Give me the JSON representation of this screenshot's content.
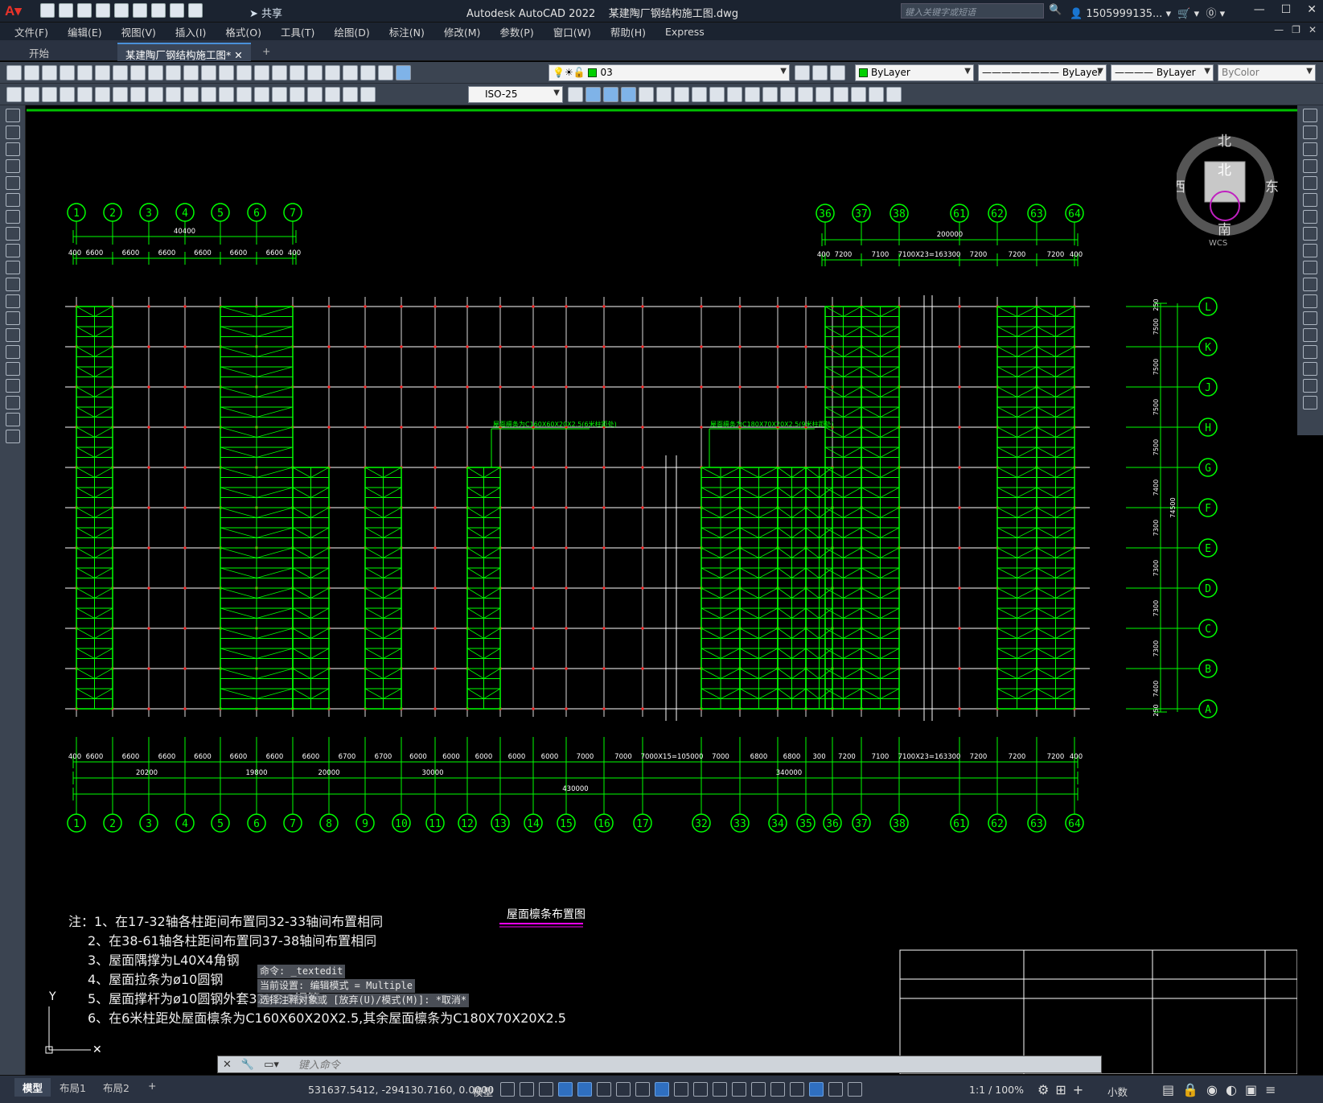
{
  "app": {
    "title": "Autodesk AutoCAD 2022",
    "file": "某建陶厂钢结构施工图.dwg",
    "share_label": "共享"
  },
  "search": {
    "placeholder": "键入关键字或短语"
  },
  "user": {
    "name": "1505999135..."
  },
  "menu": [
    "文件(F)",
    "编辑(E)",
    "视图(V)",
    "插入(I)",
    "格式(O)",
    "工具(T)",
    "绘图(D)",
    "标注(N)",
    "修改(M)",
    "参数(P)",
    "窗口(W)",
    "帮助(H)",
    "Express"
  ],
  "tabs": {
    "start": "开始",
    "drawing": "某建陶厂钢结构施工图*",
    "add": "+"
  },
  "toolbar": {
    "layer": "03",
    "color": "ByLayer",
    "linetype": "ByLayer",
    "lineweight": "ByLayer",
    "plotstyle": "ByColor",
    "dimstyle": "ISO-25"
  },
  "viewcube": {
    "north": "北",
    "south": "南",
    "east": "东",
    "west": "西",
    "top": "北",
    "wcs": "WCS"
  },
  "drawing": {
    "axes_top_left": [
      "1",
      "2",
      "3",
      "4",
      "5",
      "6",
      "7"
    ],
    "axes_top_right": [
      "36",
      "37",
      "38",
      "61",
      "62",
      "63",
      "64"
    ],
    "axes_bottom": [
      "1",
      "2",
      "3",
      "4",
      "5",
      "6",
      "7",
      "8",
      "9",
      "10",
      "11",
      "12",
      "13",
      "14",
      "15",
      "16",
      "17",
      "32",
      "33",
      "34",
      "35",
      "36",
      "37",
      "38",
      "61",
      "62",
      "63",
      "64"
    ],
    "axes_right": [
      "L",
      "K",
      "J",
      "H",
      "G",
      "F",
      "E",
      "D",
      "C",
      "B",
      "A"
    ],
    "top_left_total": "40400",
    "top_left_dims": [
      "400",
      "6600",
      "6600",
      "6600",
      "6600",
      "6600",
      "6600",
      "400"
    ],
    "top_right_total": "200000",
    "top_right_dims": [
      "400",
      "7200",
      "7100",
      "7100X23=163300",
      "7200",
      "7200",
      "7200",
      "400"
    ],
    "bottom_dims": [
      "400",
      "6600",
      "6600",
      "6600",
      "6600",
      "6600",
      "6600",
      "6600",
      "6700",
      "6700",
      "6000",
      "6000",
      "6000",
      "6000",
      "6000",
      "7000",
      "7000",
      "7000X15=105000",
      "7000",
      "6800",
      "6800",
      "300",
      "7200",
      "7100",
      "7100X23=163300",
      "7200",
      "7200",
      "7200",
      "400"
    ],
    "bottom_sub": [
      "20200",
      "19800",
      "20000",
      "30000",
      "340000"
    ],
    "bottom_total": "430000",
    "right_dims": [
      "250",
      "7500",
      "7500",
      "7500",
      "7500",
      "7400",
      "7300",
      "7300",
      "7300",
      "7300",
      "7400",
      "250"
    ],
    "right_total": "74500",
    "purlin_label_1": "屋面檩条为C160X60X20X2.5(6米柱距处)",
    "purlin_label_2": "屋面檩条为C180X70X20X2.5(9米柱距处)",
    "drawing_title": "屋面檩条布置图"
  },
  "notes": [
    "注：1、在17-32轴各柱距间布置同32-33轴间布置相同",
    "2、在38-61轴各柱距间布置同37-38轴间布置相同",
    "3、屋面隅撑为L40X4角钢",
    "4、屋面拉条为ø10圆钢",
    "5、屋面撑杆为ø10圆钢外套32X2.0钢管",
    "6、在6米柱距处屋面檩条为C160X60X20X2.5,其余屋面檩条为C180X70X20X2.5"
  ],
  "command": {
    "history": [
      "命令: _textedit",
      "当前设置: 编辑模式 = Multiple",
      "选择注释对象或 [放弃(U)/模式(M)]: *取消*"
    ],
    "placeholder": "键入命令"
  },
  "status": {
    "layouts": [
      "模型",
      "布局1",
      "布局2",
      "+"
    ],
    "coords": "531637.5412, -294130.7160, 0.0000",
    "space": "模型",
    "scale": "1:1 / 100%",
    "units": "小数"
  },
  "colors": {
    "accent": "#00ff00",
    "titlebar": "#1b2330",
    "canvas": "#000000",
    "grid": "#ffffff",
    "magenta": "#ff00ff"
  }
}
